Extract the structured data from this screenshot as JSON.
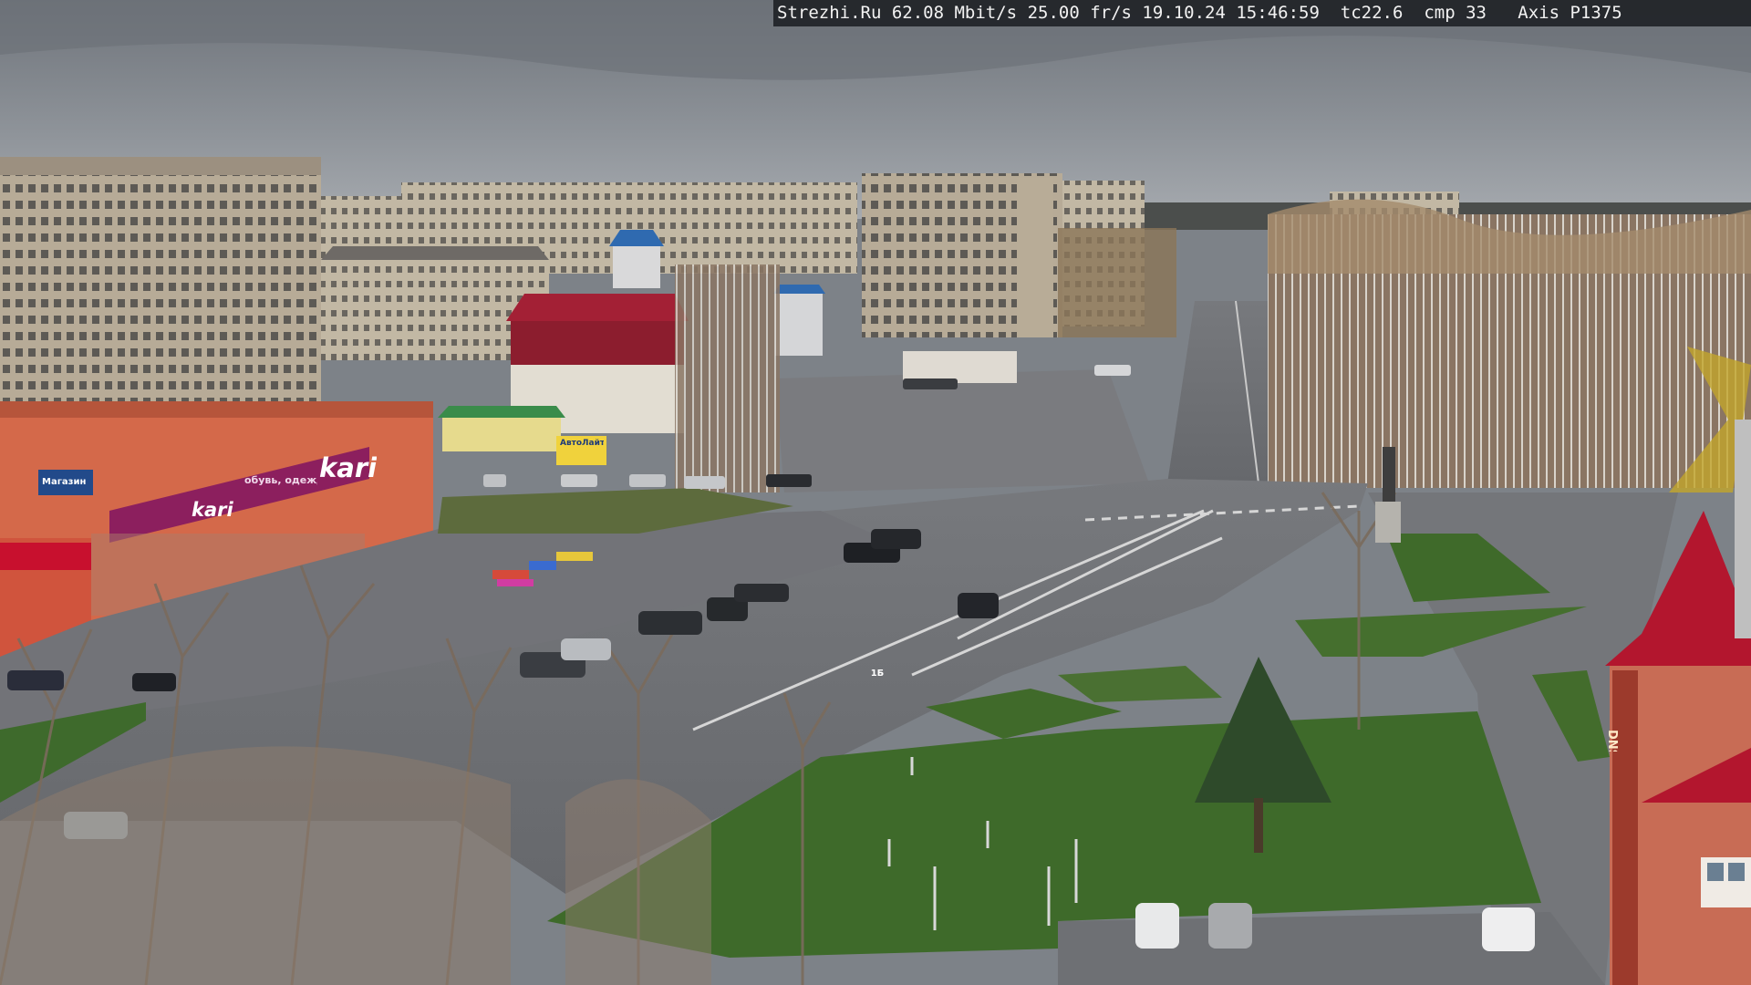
{
  "camera_overlay": {
    "site": "Strezhi.Ru",
    "bitrate": "62.08 Mbit/s",
    "framerate": "25.00 fr/s",
    "datetime": "19.10.24 15:46:59",
    "tc": "tc22.6",
    "cmp": "cmp 33",
    "camera_model": "Axis P1375"
  },
  "signage": {
    "kari_rooftop": "kari",
    "kari_lower": "kari",
    "kari_slogan": "обувь, одежда",
    "shop_left": "Магазин",
    "billboard": "АвтоЛайт",
    "route_sign": "1Б",
    "tower_sign": "DNS"
  },
  "colors": {
    "sky": "#878c93",
    "kari_brand": "#8c1f5e",
    "red_roof": "#b3162e",
    "grass": "#3f6a2a",
    "asphalt": "#6f7074"
  }
}
